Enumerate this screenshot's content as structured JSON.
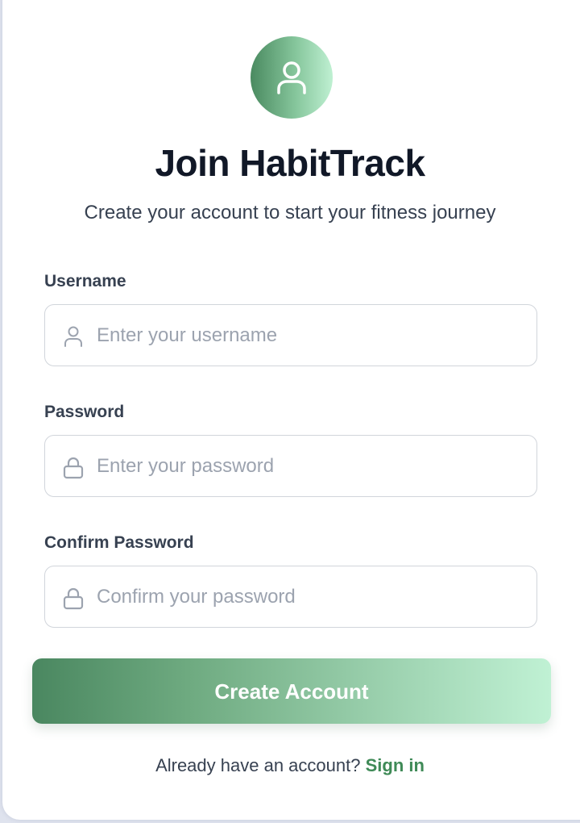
{
  "header": {
    "avatar_icon": "user-icon",
    "title": "Join HabitTrack",
    "subtitle": "Create your account to start your fitness journey"
  },
  "form": {
    "username": {
      "label": "Username",
      "placeholder": "Enter your username",
      "value": "",
      "icon": "user-icon"
    },
    "password": {
      "label": "Password",
      "placeholder": "Enter your password",
      "value": "",
      "icon": "lock-icon"
    },
    "confirm_password": {
      "label": "Confirm Password",
      "placeholder": "Confirm your password",
      "value": "",
      "icon": "lock-icon"
    },
    "submit_label": "Create Account"
  },
  "footer": {
    "prompt": "Already have an account?",
    "link_label": "Sign in"
  },
  "colors": {
    "accent_dark": "#4a8760",
    "accent_light": "#c0f1d4",
    "link": "#3f8a57",
    "title": "#111827",
    "placeholder": "#9ca3af"
  }
}
